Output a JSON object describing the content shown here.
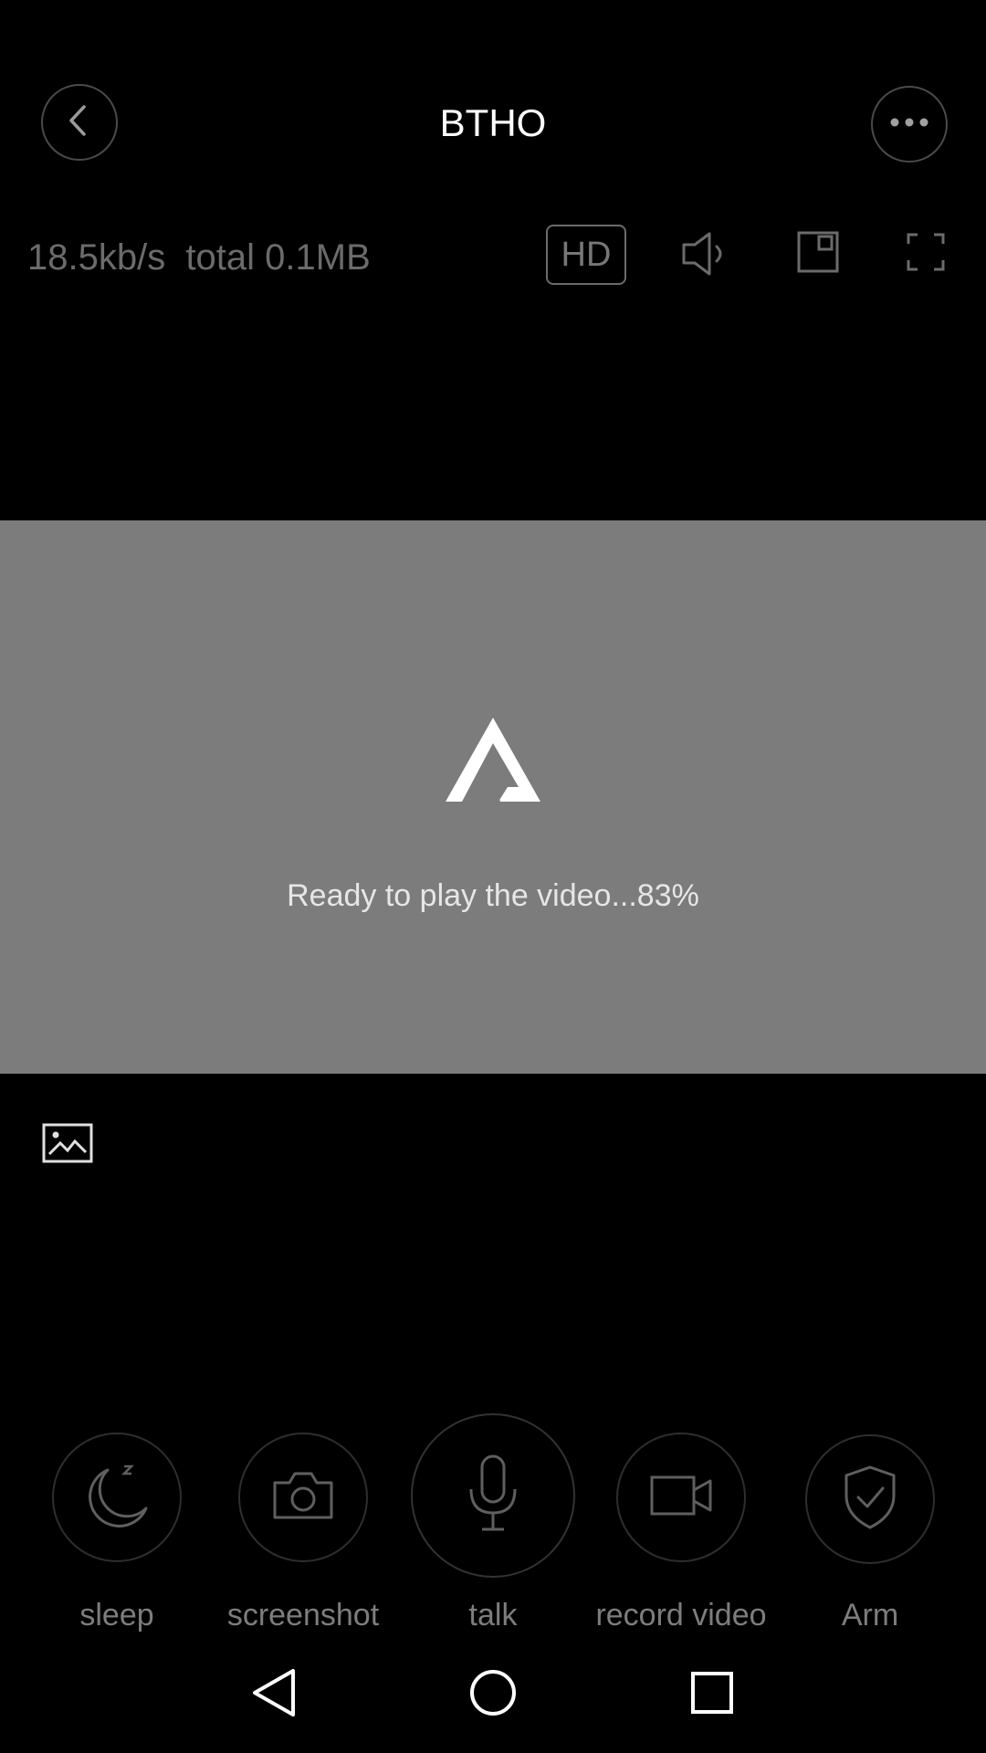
{
  "header": {
    "title": "BTHO",
    "back_icon": "chevron-left-icon",
    "more_icon": "more-horizontal-icon"
  },
  "stream": {
    "stats": "18.5kb/s  total 0.1MB",
    "quality_label": "HD"
  },
  "controls": {
    "sound_icon": "speaker-icon",
    "pip_icon": "picture-in-picture-icon",
    "fullscreen_icon": "fullscreen-icon"
  },
  "video": {
    "status": "Ready to play the video...83%",
    "progress_percent": 83,
    "background_color": "#7c7c7c"
  },
  "gallery": {
    "icon": "gallery-image-icon"
  },
  "actions": [
    {
      "label": "sleep",
      "icon": "moon-sleep-icon"
    },
    {
      "label": "screenshot",
      "icon": "camera-icon"
    },
    {
      "label": "talk",
      "icon": "microphone-icon"
    },
    {
      "label": "record video",
      "icon": "video-camera-icon"
    },
    {
      "label": "Arm",
      "icon": "shield-check-icon"
    }
  ],
  "system_nav": {
    "back": "triangle-back-icon",
    "home": "circle-home-icon",
    "recents": "square-recents-icon"
  }
}
